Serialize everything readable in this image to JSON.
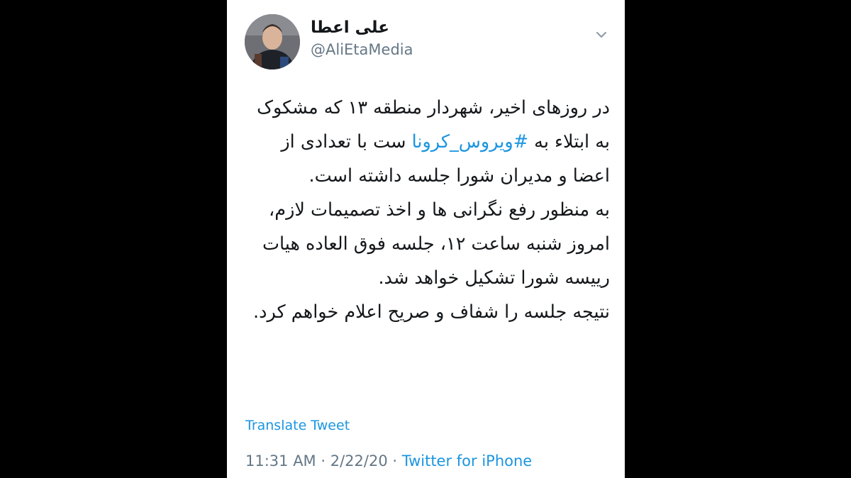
{
  "tweet": {
    "display_name": "علی اعطا",
    "handle": "@AliEtaMedia",
    "text_before": "در روزهای اخیر، شهردار منطقه ۱۳ که مشکوک به ابتلاء به ",
    "hashtag": "#ویروس_کرونا",
    "text_after": " ست با تعدادی از اعضا و مدیران شورا جلسه داشته است.\nبه منظور رفع نگرانی ها و اخذ تصمیمات لازم، امروز  شنبه ساعت ۱۲، جلسه فوق العاده هیات رییسه شورا تشکیل خواهد شد.\nنتیجه جلسه را شفاف و صریح اعلام خواهم کرد.",
    "translate_label": "Translate Tweet",
    "time": "11:31 AM",
    "separator": " · ",
    "date": "2/22/20",
    "source": "Twitter for iPhone"
  },
  "icons": {
    "menu": "chevron-down-icon",
    "avatar": "avatar"
  },
  "colors": {
    "link": "#1b95e0",
    "secondary": "#657786",
    "text": "#14171a"
  }
}
